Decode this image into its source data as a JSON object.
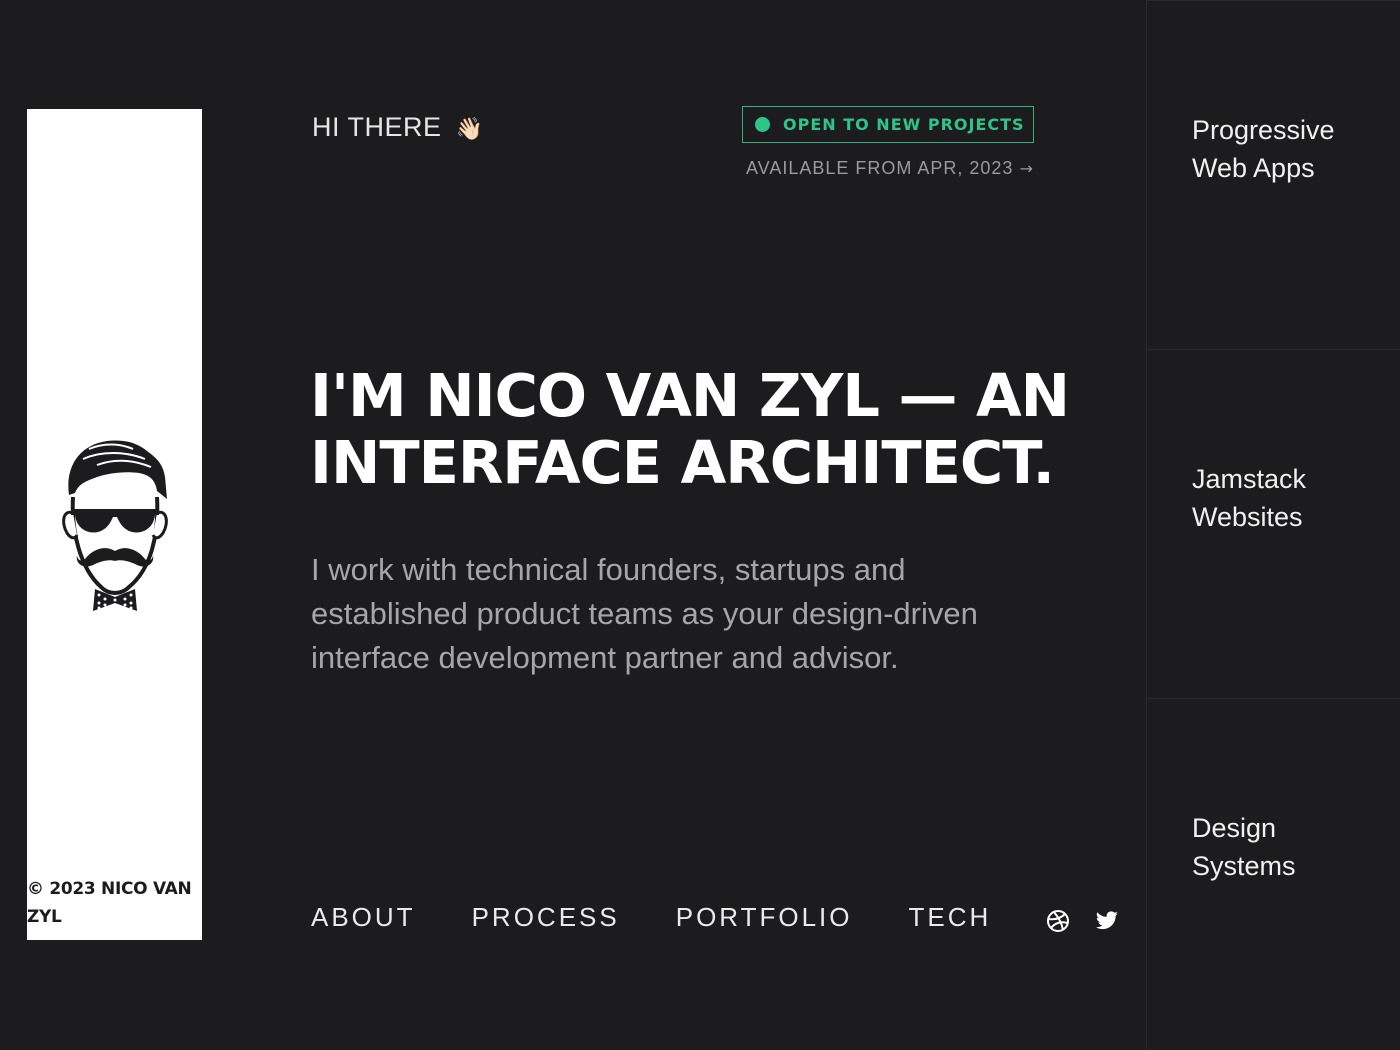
{
  "sidebar": {
    "copyright": "© 2023 NICO VAN ZYL",
    "avatar_icon": "mustache-man-sunglasses-avatar"
  },
  "header": {
    "greeting": "HI THERE",
    "greeting_emoji": "👋🏻",
    "status_label": "OPEN TO NEW PROJECTS",
    "availability": "AVAILABLE FROM APR, 2023",
    "availability_arrow": "→"
  },
  "hero": {
    "headline": "I'M NICO VAN ZYL — AN INTERFACE ARCHITECT.",
    "intro": "I work with technical founders, startups and established product teams as your design-driven interface development partner and advisor."
  },
  "nav": {
    "items": [
      "ABOUT",
      "PROCESS",
      "PORTFOLIO",
      "TECH"
    ]
  },
  "social": {
    "icons": [
      "dribbble-icon",
      "twitter-icon"
    ]
  },
  "services": {
    "items": [
      "Progressive Web Apps",
      "Jamstack Websites",
      "Design Systems"
    ]
  },
  "colors": {
    "background": "#1c1c1e",
    "accent": "#2ec589",
    "sidebar": "#ffffff"
  }
}
